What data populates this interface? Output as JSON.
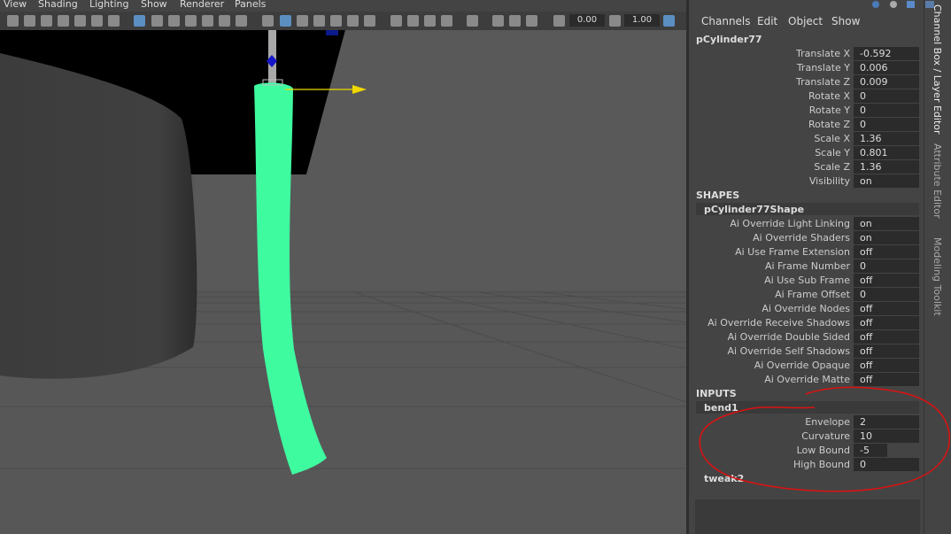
{
  "menubar": {
    "items": [
      "View",
      "Shading",
      "Lighting",
      "Show",
      "Renderer",
      "Panels"
    ]
  },
  "toolbar": {
    "field1": "0.00",
    "field2": "1.00"
  },
  "channel_box": {
    "menu": [
      "Channels",
      "Edit",
      "Object",
      "Show"
    ],
    "object_name": "pCylinder77",
    "transforms": [
      {
        "label": "Translate X",
        "value": "-0.592"
      },
      {
        "label": "Translate Y",
        "value": "0.006"
      },
      {
        "label": "Translate Z",
        "value": "0.009"
      },
      {
        "label": "Rotate X",
        "value": "0"
      },
      {
        "label": "Rotate Y",
        "value": "0"
      },
      {
        "label": "Rotate Z",
        "value": "0"
      },
      {
        "label": "Scale X",
        "value": "1.36"
      },
      {
        "label": "Scale Y",
        "value": "0.801"
      },
      {
        "label": "Scale Z",
        "value": "1.36"
      },
      {
        "label": "Visibility",
        "value": "on"
      }
    ],
    "shapes_header": "SHAPES",
    "shape_node": "pCylinder77Shape",
    "shape_attrs": [
      {
        "label": "Ai Override Light Linking",
        "value": "on"
      },
      {
        "label": "Ai Override Shaders",
        "value": "on"
      },
      {
        "label": "Ai Use Frame Extension",
        "value": "off"
      },
      {
        "label": "Ai Frame Number",
        "value": "0"
      },
      {
        "label": "Ai Use Sub Frame",
        "value": "off"
      },
      {
        "label": "Ai Frame Offset",
        "value": "0"
      },
      {
        "label": "Ai Override Nodes",
        "value": "off"
      },
      {
        "label": "Ai Override Receive Shadows",
        "value": "off"
      },
      {
        "label": "Ai Override Double Sided",
        "value": "off"
      },
      {
        "label": "Ai Override Self Shadows",
        "value": "off"
      },
      {
        "label": "Ai Override Opaque",
        "value": "off"
      },
      {
        "label": "Ai Override Matte",
        "value": "off"
      }
    ],
    "inputs_header": "INPUTS",
    "input_node": "bend1",
    "input_attrs": [
      {
        "label": "Envelope",
        "value": "2"
      },
      {
        "label": "Curvature",
        "value": "10"
      },
      {
        "label": "Low Bound",
        "value": "-5"
      },
      {
        "label": "High Bound",
        "value": "0"
      }
    ],
    "tweak_node": "tweak2"
  },
  "side_tabs": [
    "Channel Box / Layer Editor",
    "Attribute Editor",
    "Modeling Toolkit"
  ],
  "colors": {
    "cylinder": "#3ffba0",
    "annotation": "#dd1111",
    "viewport": "#575757",
    "panel": "#444444"
  }
}
